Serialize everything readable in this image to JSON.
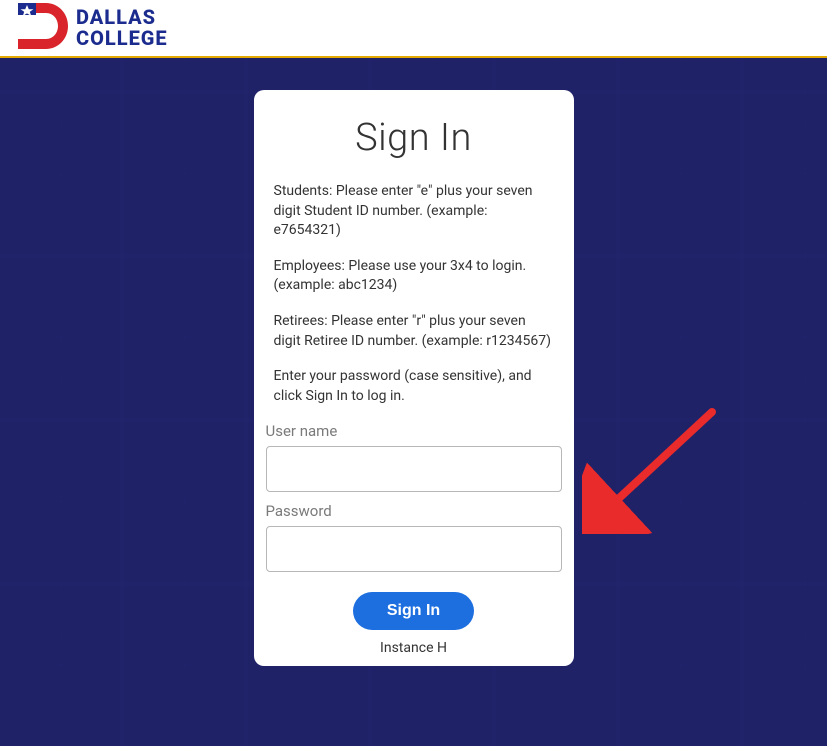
{
  "brand": {
    "line1": "DALLAS",
    "line2": "COLLEGE"
  },
  "card": {
    "title": "Sign In",
    "instructions": {
      "students": "Students: Please enter \"e\" plus your seven digit Student ID number. (example: e7654321)",
      "employees": "Employees: Please use your 3x4 to login. (example: abc1234)",
      "retirees": "Retirees: Please enter \"r\" plus your seven digit Retiree ID number. (example: r1234567)",
      "password": "Enter your password (case sensitive), and click Sign In to log in."
    },
    "labels": {
      "username": "User name",
      "password": "Password"
    },
    "values": {
      "username": "",
      "password": ""
    },
    "button": "Sign In",
    "instance": "Instance H"
  },
  "annotation": {
    "arrow_color": "#e92b2b"
  }
}
